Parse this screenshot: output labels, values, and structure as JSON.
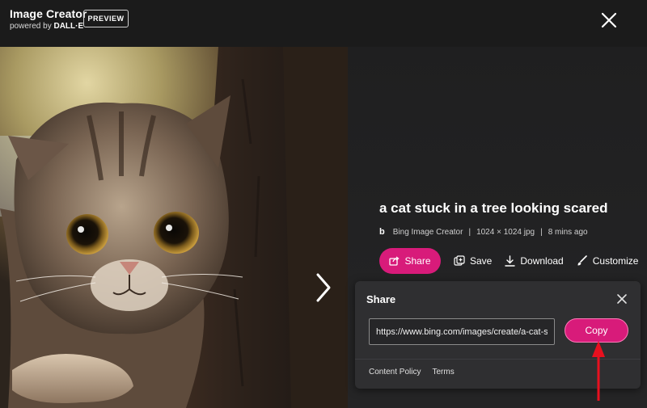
{
  "header": {
    "app_title": "Image Creator",
    "powered_prefix": "powered by ",
    "powered_brand": "DALL·E",
    "preview_badge": "PREVIEW"
  },
  "image": {
    "title": "a cat stuck in a tree looking scared",
    "source": "Bing Image Creator",
    "source_icon": "bing-b",
    "dimensions": "1024 × 1024 jpg",
    "age": "8 mins ago"
  },
  "actions": {
    "share": "Share",
    "save": "Save",
    "download": "Download",
    "customize": "Customize"
  },
  "share_popup": {
    "title": "Share",
    "url": "https://www.bing.com/images/create/a-cat-stuck-in-a-tree-looking-scared",
    "copy_label": "Copy",
    "links": {
      "content_policy": "Content Policy",
      "terms": "Terms"
    }
  },
  "colors": {
    "accent": "#d81b7a",
    "annotation_arrow": "#e8101f",
    "background": "#1c1c1d"
  }
}
